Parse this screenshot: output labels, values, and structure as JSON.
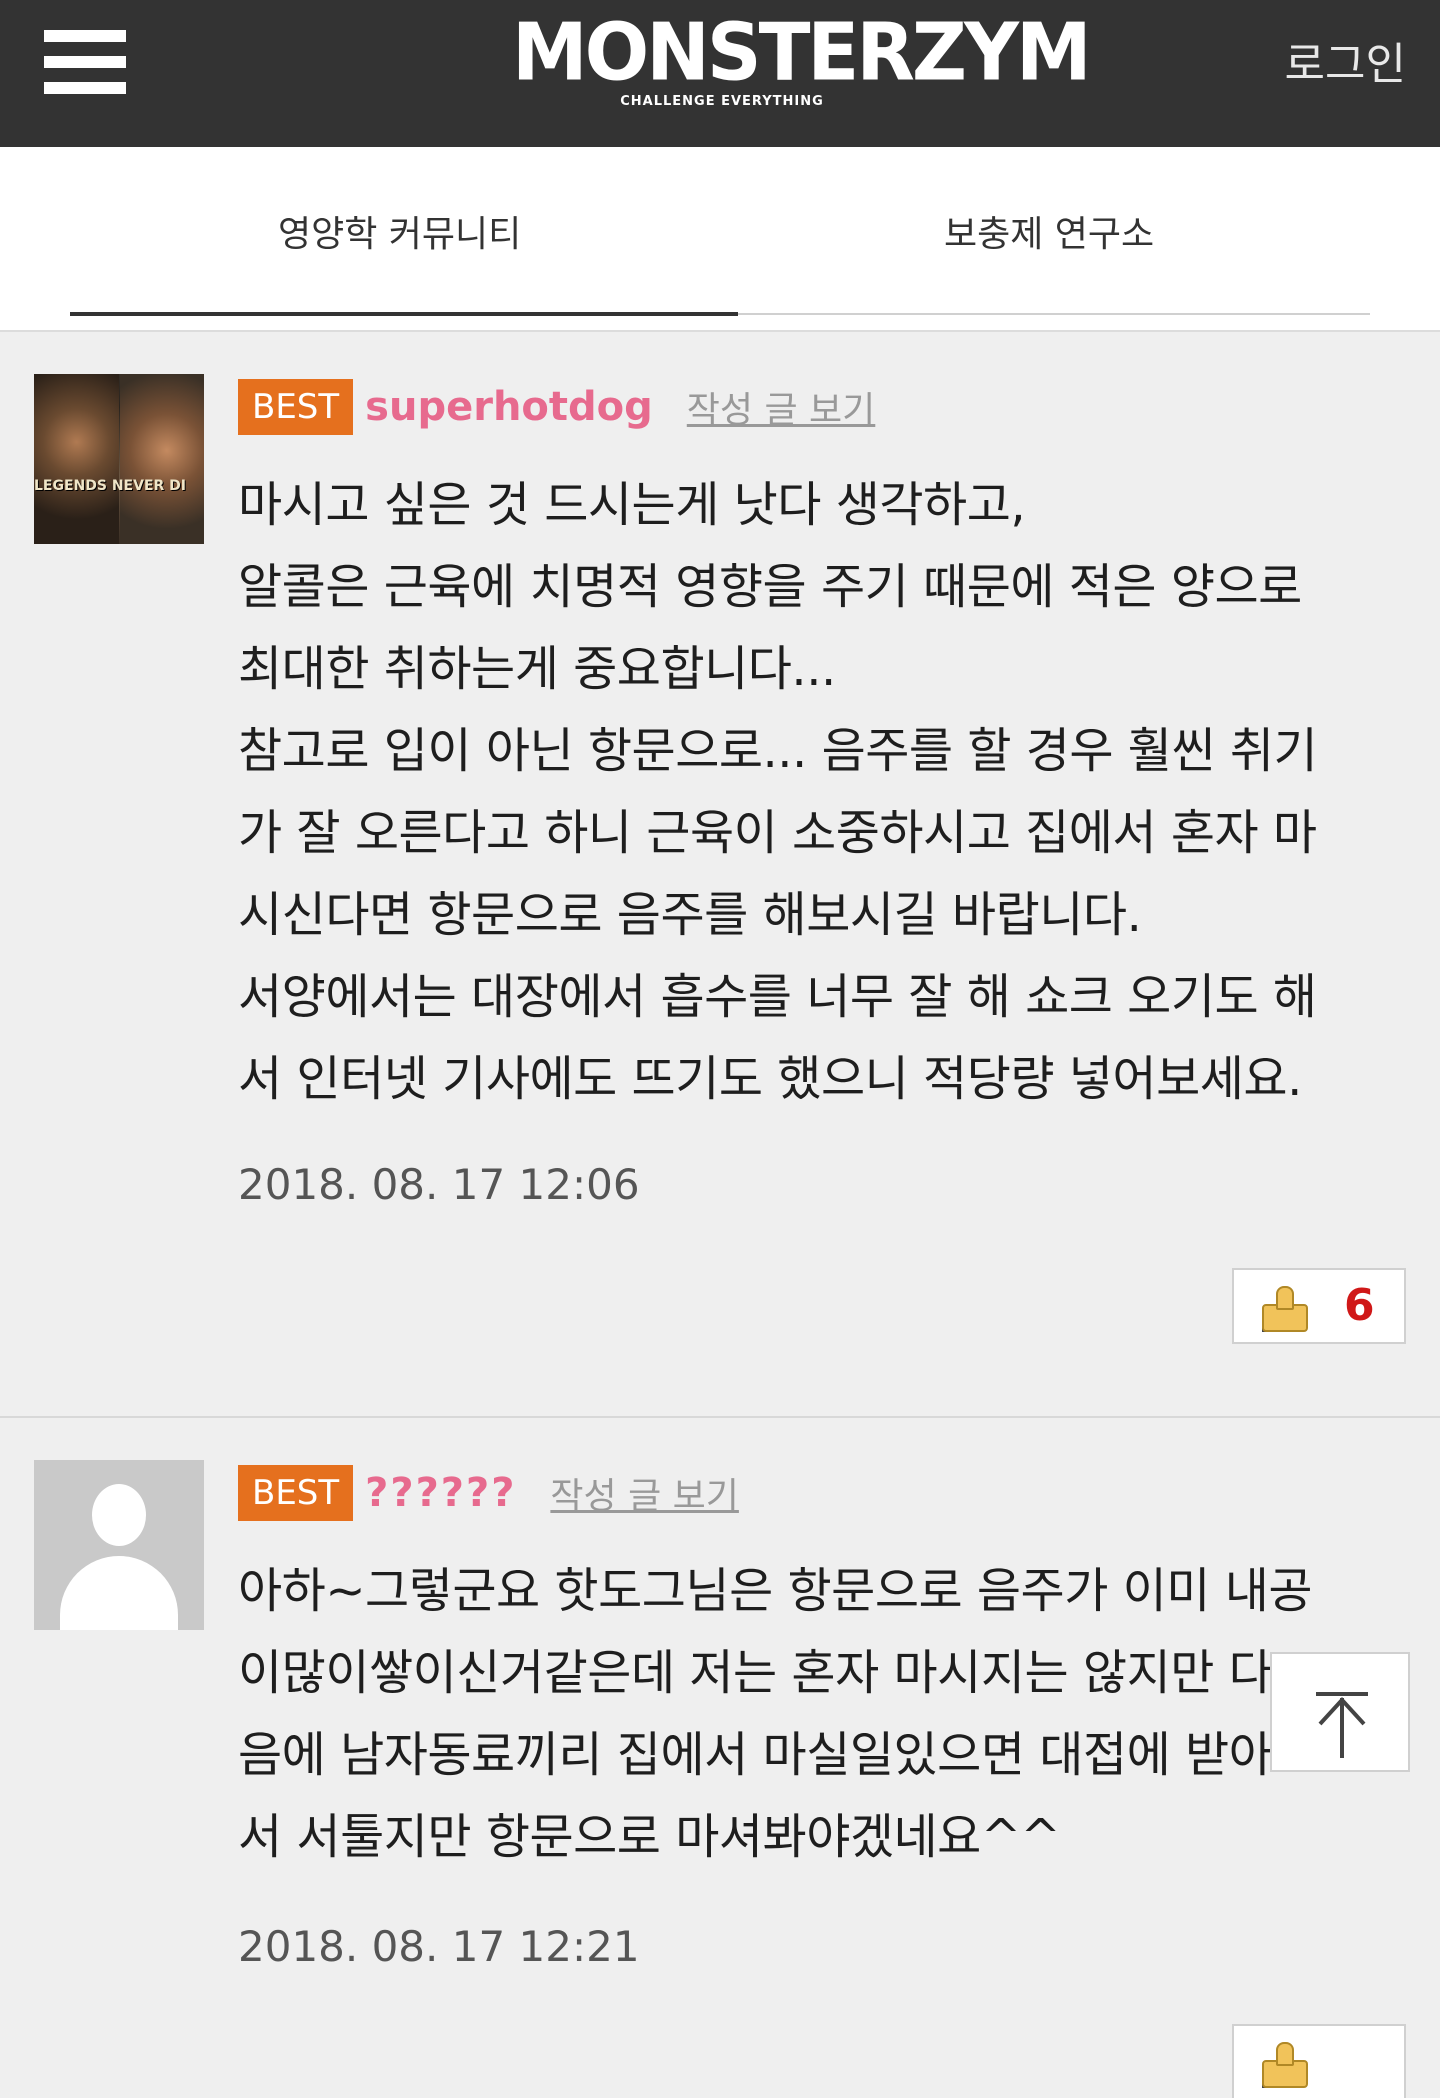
{
  "header": {
    "logo_main": "MONSTERZYM",
    "logo_tagline": "CHALLENGE EVERYTHING",
    "login_label": "로그인",
    "menu_icon": "hamburger-menu-icon",
    "bg_color": "#333333"
  },
  "tabs": [
    {
      "label": "영양학 커뮤니티",
      "active": true
    },
    {
      "label": "보충제 연구소",
      "active": false
    }
  ],
  "comments": [
    {
      "badge": "BEST",
      "nickname": "superhotdog",
      "view_posts_label": "작성 글 보기",
      "avatar_caption": "LEGENDS NEVER DI",
      "body": "마시고 싶은 것 드시는게 낫다 생각하고,\n알콜은 근육에 치명적 영향을 주기 때문에 적은 양으로\n최대한 취하는게 중요합니다...\n참고로 입이 아닌 항문으로... 음주를 할 경우 훨씬 취기\n가 잘 오른다고 하니 근육이 소중하시고 집에서 혼자 마\n시신다면 항문으로 음주를 해보시길 바랍니다.\n서양에서는 대장에서 흡수를 너무 잘 해 쇼크 오기도 해\n서 인터넷 기사에도 뜨기도 했으니 적당량 넣어보세요.",
      "date": "2018. 08. 17 12:06",
      "likes": "6"
    },
    {
      "badge": "BEST",
      "nickname": "??????",
      "view_posts_label": "작성 글 보기",
      "body": "아하~그렇군요 핫도그님은 항문으로 음주가 이미 내공\n이많이쌓이신거같은데 저는 혼자 마시지는 않지만 다\n음에 남자동료끼리 집에서 마실일있으면 대접에 받아\n서 서툴지만 항문으로 마셔봐야겠네요^^",
      "date": "2018. 08. 17 12:21"
    }
  ],
  "colors": {
    "badge": "#e5701e",
    "nickname": "#e76a8e",
    "like_count": "#d01818"
  }
}
